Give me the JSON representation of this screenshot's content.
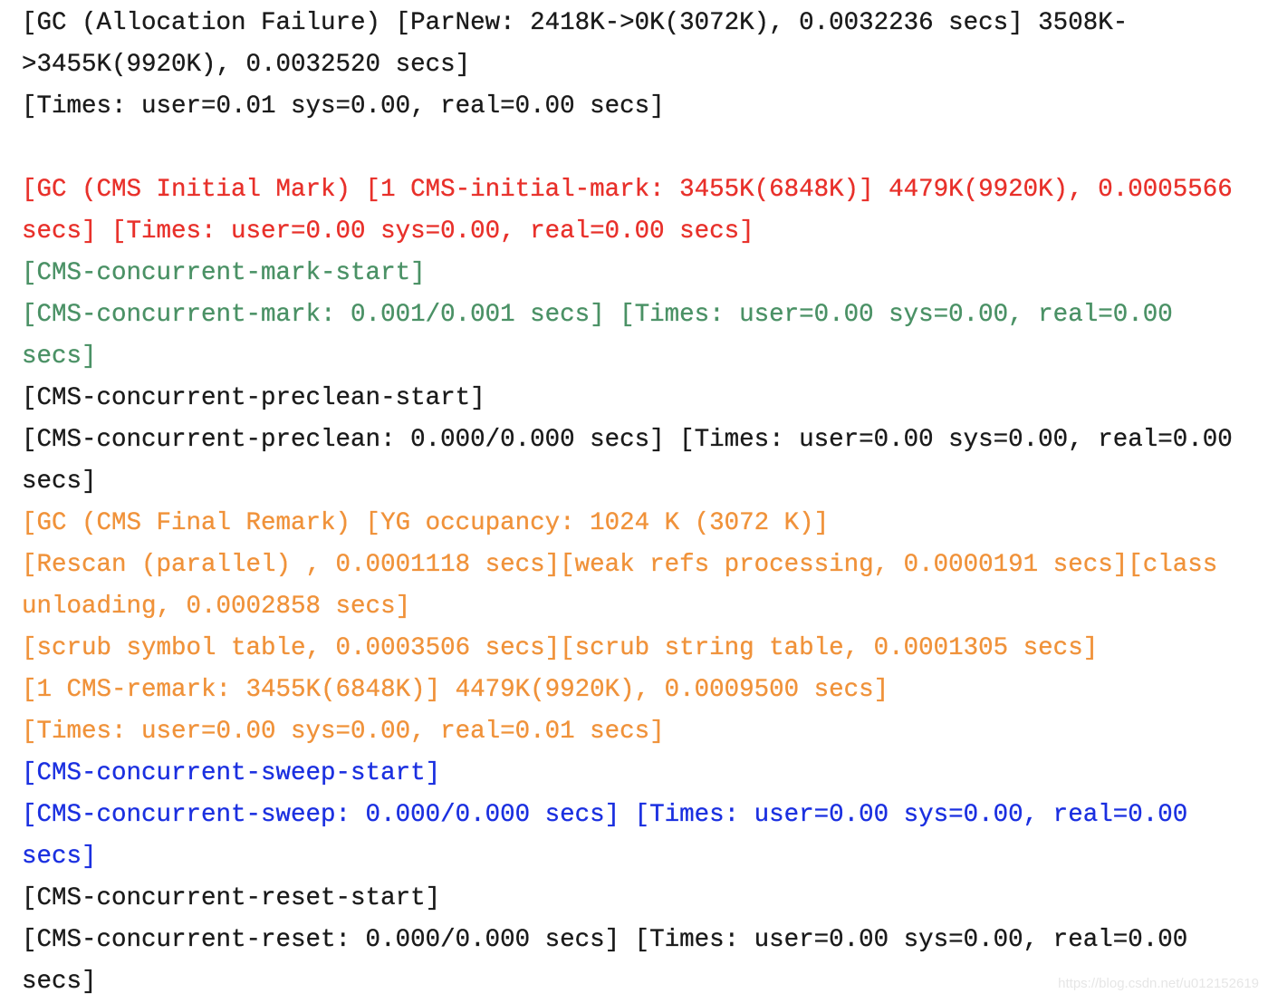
{
  "colors": {
    "black": "#1a1a1a",
    "red": "#e8302a",
    "green": "#4a9165",
    "orange": "#f0923a",
    "blue": "#1a2fe0"
  },
  "lines": [
    {
      "text": "[GC (Allocation Failure) [ParNew: 2418K->0K(3072K), 0.0032236 secs] 3508K-",
      "color": "black"
    },
    {
      "text": ">3455K(9920K), 0.0032520 secs]",
      "color": "black"
    },
    {
      "text": "[Times: user=0.01 sys=0.00, real=0.00 secs]",
      "color": "black"
    },
    {
      "text": "",
      "color": "black"
    },
    {
      "text": "[GC (CMS Initial Mark) [1 CMS-initial-mark: 3455K(6848K)] 4479K(9920K), 0.0005566",
      "color": "red"
    },
    {
      "text": "secs] [Times: user=0.00 sys=0.00, real=0.00 secs]",
      "color": "red"
    },
    {
      "text": "[CMS-concurrent-mark-start]",
      "color": "green"
    },
    {
      "text": "[CMS-concurrent-mark: 0.001/0.001 secs] [Times: user=0.00 sys=0.00, real=0.00",
      "color": "green"
    },
    {
      "text": "secs]",
      "color": "green"
    },
    {
      "text": "[CMS-concurrent-preclean-start]",
      "color": "black"
    },
    {
      "text": "[CMS-concurrent-preclean: 0.000/0.000 secs] [Times: user=0.00 sys=0.00, real=0.00",
      "color": "black"
    },
    {
      "text": "secs]",
      "color": "black"
    },
    {
      "text": "[GC (CMS Final Remark) [YG occupancy: 1024 K (3072 K)]",
      "color": "orange"
    },
    {
      "text": "[Rescan (parallel) , 0.0001118 secs][weak refs processing, 0.0000191 secs][class",
      "color": "orange"
    },
    {
      "text": "unloading, 0.0002858 secs]",
      "color": "orange"
    },
    {
      "text": "[scrub symbol table, 0.0003506 secs][scrub string table, 0.0001305 secs]",
      "color": "orange"
    },
    {
      "text": "[1 CMS-remark: 3455K(6848K)] 4479K(9920K), 0.0009500 secs]",
      "color": "orange"
    },
    {
      "text": "[Times: user=0.00 sys=0.00, real=0.01 secs]",
      "color": "orange"
    },
    {
      "text": "[CMS-concurrent-sweep-start]",
      "color": "blue"
    },
    {
      "text": "[CMS-concurrent-sweep: 0.000/0.000 secs] [Times: user=0.00 sys=0.00, real=0.00",
      "color": "blue"
    },
    {
      "text": "secs]",
      "color": "blue"
    },
    {
      "text": "[CMS-concurrent-reset-start]",
      "color": "black"
    },
    {
      "text": "[CMS-concurrent-reset: 0.000/0.000 secs] [Times: user=0.00 sys=0.00, real=0.00",
      "color": "black"
    },
    {
      "text": "secs]",
      "color": "black"
    }
  ],
  "watermark": "https://blog.csdn.net/u012152619"
}
